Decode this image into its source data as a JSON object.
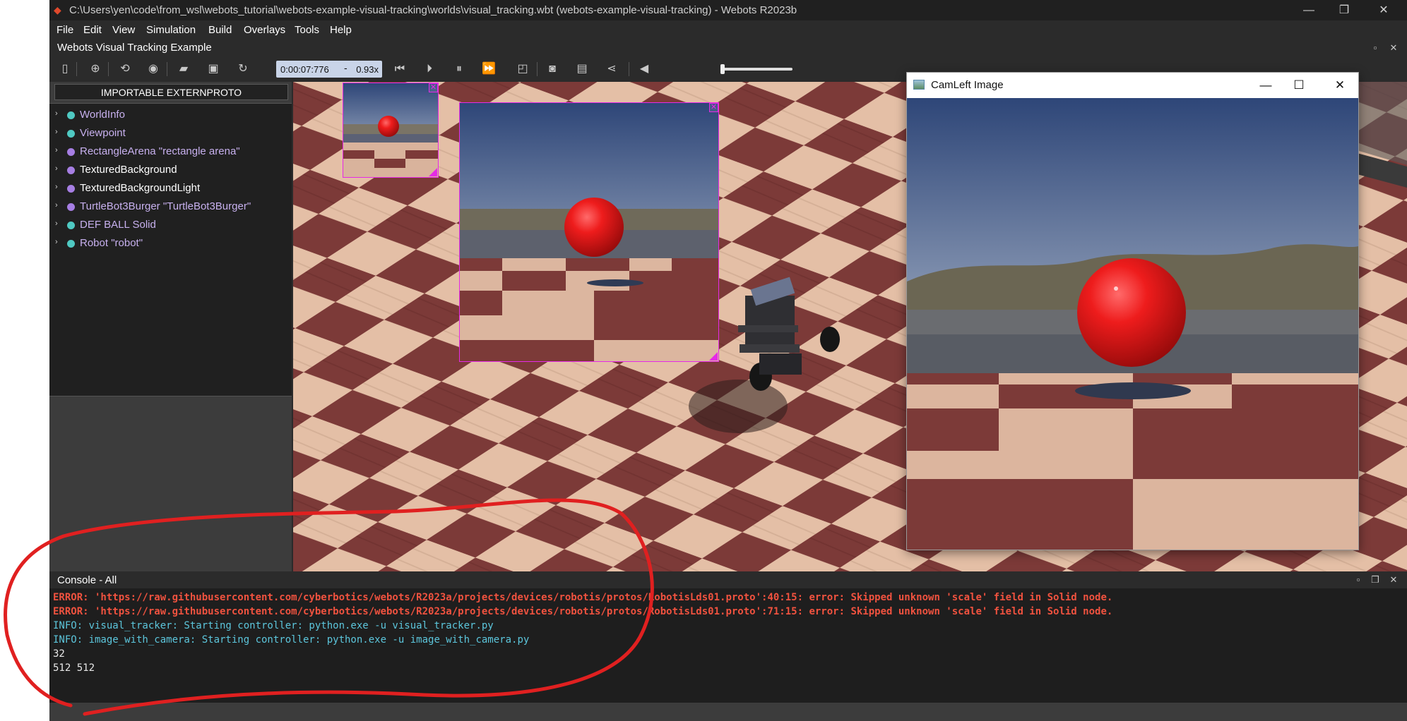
{
  "window": {
    "title": "C:\\Users\\yen\\code\\from_wsl\\webots_tutorial\\webots-example-visual-tracking\\worlds\\visual_tracking.wbt (webots-example-visual-tracking) - Webots R2023b",
    "minimize": "—",
    "maximize": "❐",
    "close": "✕"
  },
  "menu": [
    "File",
    "Edit",
    "View",
    "Simulation",
    "Build",
    "Overlays",
    "Tools",
    "Help"
  ],
  "world_title": "Webots Visual Tracking Example",
  "toolbar": {
    "time": "0:00:07:776",
    "minus": "-",
    "speed": "0.93x"
  },
  "left_panel": {
    "externproto_button": "IMPORTABLE EXTERNPROTO",
    "tree": [
      {
        "label": "WorldInfo",
        "color": "#4fc9c2",
        "text_color": "#c7b0ee"
      },
      {
        "label": "Viewpoint",
        "color": "#4fc9c2",
        "text_color": "#c7b0ee"
      },
      {
        "label": "RectangleArena \"rectangle arena\"",
        "color": "#a67ee3",
        "text_color": "#c7b0ee"
      },
      {
        "label": "TexturedBackground",
        "color": "#a67ee3",
        "text_color": "#ffffff"
      },
      {
        "label": "TexturedBackgroundLight",
        "color": "#a67ee3",
        "text_color": "#ffffff"
      },
      {
        "label": "TurtleBot3Burger \"TurtleBot3Burger\"",
        "color": "#a67ee3",
        "text_color": "#c7b0ee"
      },
      {
        "label": "DEF BALL Solid",
        "color": "#4fc9c2",
        "text_color": "#c7b0ee"
      },
      {
        "label": "Robot \"robot\"",
        "color": "#4fc9c2",
        "text_color": "#c7b0ee"
      }
    ]
  },
  "camera_window": {
    "title": "CamLeft Image",
    "minimize": "—",
    "maximize": "☐",
    "close": "✕"
  },
  "console": {
    "title": "Console - All",
    "lines": [
      {
        "text": "ERROR: 'https://raw.githubusercontent.com/cyberbotics/webots/R2023a/projects/devices/robotis/protos/RobotisLds01.proto':40:15: error: Skipped unknown 'scale' field in Solid node.",
        "color": "#f0523f",
        "bold": true
      },
      {
        "text": "ERROR: 'https://raw.githubusercontent.com/cyberbotics/webots/R2023a/projects/devices/robotis/protos/RobotisLds01.proto':71:15: error: Skipped unknown 'scale' field in Solid node.",
        "color": "#f0523f",
        "bold": true
      },
      {
        "text": "INFO: visual_tracker: Starting controller: python.exe -u visual_tracker.py",
        "color": "#5cc6dc",
        "bold": false
      },
      {
        "text": "INFO: image_with_camera: Starting controller: python.exe -u image_with_camera.py",
        "color": "#5cc6dc",
        "bold": false
      },
      {
        "text": "32",
        "color": "#e8e8e8",
        "bold": false
      },
      {
        "text": "512 512",
        "color": "#e8e8e8",
        "bold": false
      }
    ]
  },
  "colors": {
    "overlay_border": "#e62ae6",
    "annotation_red": "#e02020",
    "ball_red": "#e01818"
  }
}
